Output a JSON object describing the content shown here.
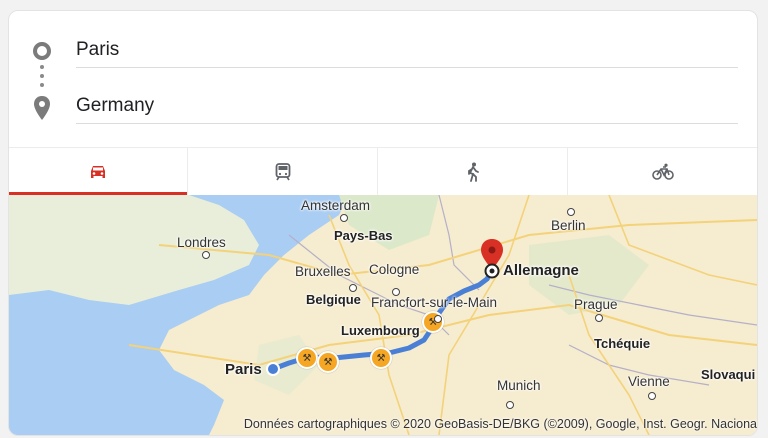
{
  "directions": {
    "origin": {
      "value": "Paris",
      "icon": "origin-circle-icon"
    },
    "destination": {
      "value": "Germany",
      "icon": "destination-pin-icon"
    }
  },
  "travel_modes": [
    {
      "name": "driving",
      "icon": "car-icon",
      "active": true,
      "color": "#d93025"
    },
    {
      "name": "transit",
      "icon": "train-icon",
      "active": false,
      "color": "#5f6368"
    },
    {
      "name": "walking",
      "icon": "walk-icon",
      "active": false,
      "color": "#5f6368"
    },
    {
      "name": "cycling",
      "icon": "bicycle-icon",
      "active": false,
      "color": "#5f6368"
    }
  ],
  "map": {
    "labels": {
      "amsterdam": "Amsterdam",
      "berlin": "Berlin",
      "londres": "Londres",
      "pays_bas": "Pays-Bas",
      "bruxelles": "Bruxelles",
      "cologne": "Cologne",
      "allemagne": "Allemagne",
      "belgique": "Belgique",
      "francfort": "Francfort-sur-le-Main",
      "prague": "Prague",
      "luxembourg": "Luxembourg",
      "tchequie": "Tchéquie",
      "paris": "Paris",
      "munich": "Munich",
      "vienne": "Vienne",
      "slovaquie": "Slovaqui"
    },
    "attribution": "Données cartographiques © 2020 GeoBasis-DE/BKG (©2009), Google, Inst. Geogr. Naciona",
    "colors": {
      "route": "#4a7fd6",
      "sea": "#a9cdf3",
      "land": "#f6eccf",
      "pin": "#d93025",
      "roadwork": "#f5a623"
    }
  }
}
